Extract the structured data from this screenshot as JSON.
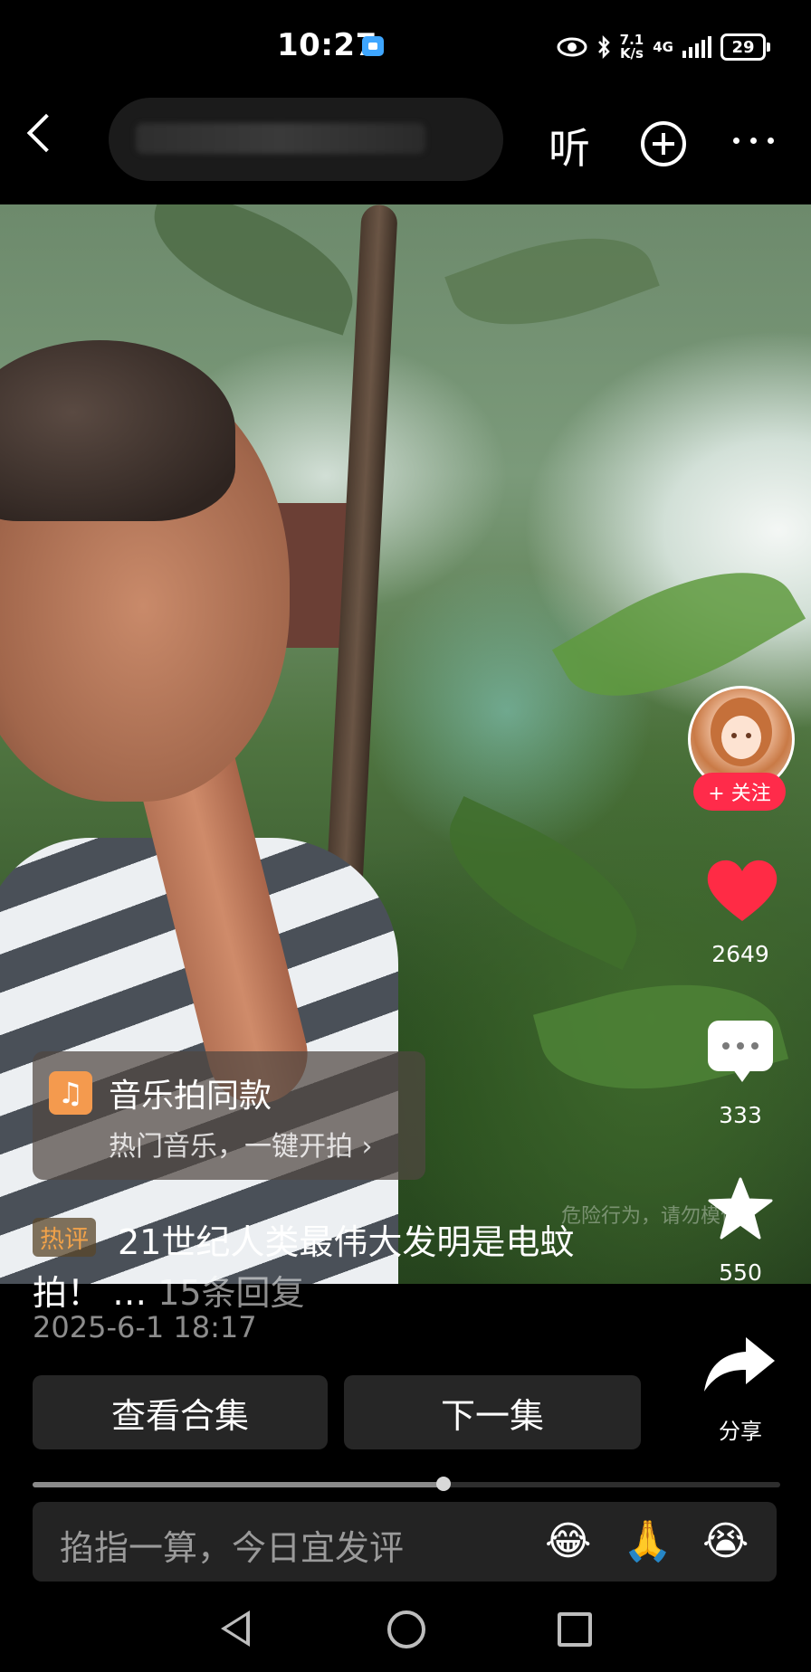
{
  "status_bar": {
    "time": "10:27",
    "speed_top": "7.1",
    "speed_bottom": "K/s",
    "network": "4G",
    "battery": "29"
  },
  "top_bar": {
    "listen_label": "听"
  },
  "side": {
    "follow_label": "+ 关注",
    "likes": "2649",
    "comments": "333",
    "favorites": "550",
    "share_label": "分享",
    "like_color": "#ff2b45"
  },
  "music_card": {
    "title": "音乐拍同款",
    "subtitle": "热门音乐，一键开拍 ›"
  },
  "hot_comment": {
    "tag": "热评",
    "text_line1": "21世纪人类最伟大发明是电蚊",
    "text_line2": "拍！ …",
    "replies": "15条回复",
    "date": "2025-6-1 18:17"
  },
  "actions": {
    "collection_label": "查看合集",
    "next_label": "下一集"
  },
  "progress": {
    "value": 0.55
  },
  "comment_input": {
    "placeholder": "掐指一算，今日宜发评",
    "emojis": [
      "😂",
      "🙏",
      "😭"
    ]
  },
  "video": {
    "watermark": "危险行为，请勿模仿"
  }
}
